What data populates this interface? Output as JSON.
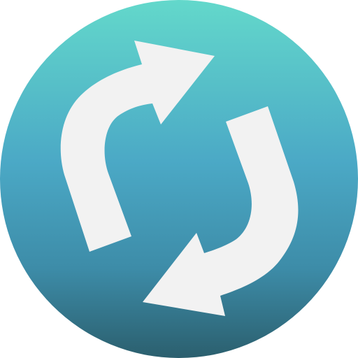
{
  "icon": {
    "name": "refresh-icon",
    "colors": {
      "gradient_top": "#63D8CB",
      "gradient_mid": "#4BA9C6",
      "gradient_lower": "#3D8CA8",
      "gradient_bottom": "#2B5F6E",
      "arrow_fill": "#F2F2F2"
    }
  }
}
